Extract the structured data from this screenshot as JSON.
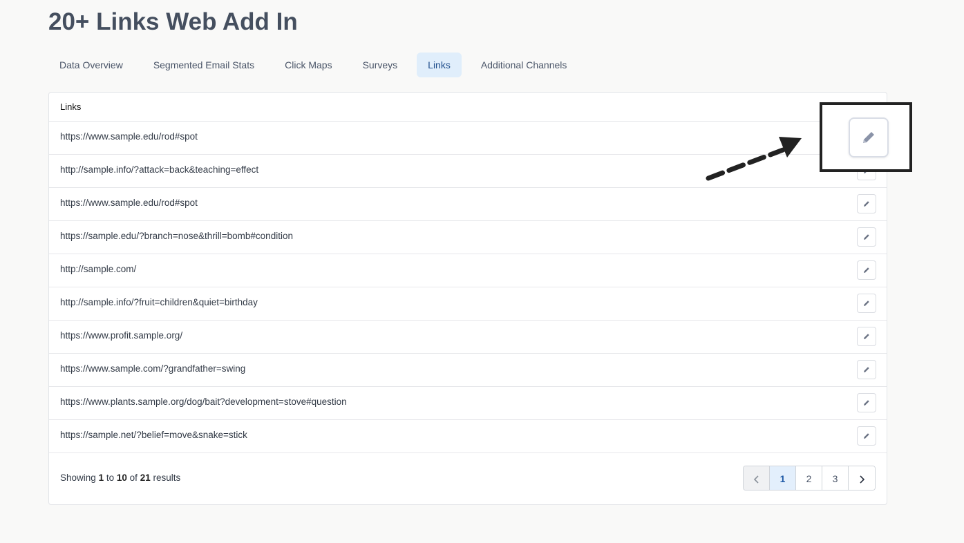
{
  "page": {
    "title": "20+ Links Web Add In"
  },
  "tabs": [
    {
      "label": "Data Overview",
      "active": false
    },
    {
      "label": "Segmented Email Stats",
      "active": false
    },
    {
      "label": "Click Maps",
      "active": false
    },
    {
      "label": "Surveys",
      "active": false
    },
    {
      "label": "Links",
      "active": true
    },
    {
      "label": "Additional Channels",
      "active": false
    }
  ],
  "table": {
    "header": "Links",
    "rows": [
      {
        "url": "https://www.sample.edu/rod#spot",
        "action_icon": "pencil-icon"
      },
      {
        "url": "http://sample.info/?attack=back&teaching=effect",
        "action_icon": "pencil-icon"
      },
      {
        "url": "https://www.sample.edu/rod#spot",
        "action_icon": "pencil-icon"
      },
      {
        "url": "https://sample.edu/?branch=nose&thrill=bomb#condition",
        "action_icon": "pencil-icon"
      },
      {
        "url": "http://sample.com/",
        "action_icon": "pencil-icon"
      },
      {
        "url": "http://sample.info/?fruit=children&quiet=birthday",
        "action_icon": "pencil-icon"
      },
      {
        "url": "https://www.profit.sample.org/",
        "action_icon": "pencil-icon"
      },
      {
        "url": "https://www.sample.com/?grandfather=swing",
        "action_icon": "pencil-icon"
      },
      {
        "url": "https://www.plants.sample.org/dog/bait?development=stove#question",
        "action_icon": "pencil-icon"
      },
      {
        "url": "https://sample.net/?belief=move&snake=stick",
        "action_icon": "pencil-icon"
      }
    ]
  },
  "footer": {
    "showing_prefix": "Showing",
    "from": "1",
    "to_word": "to",
    "to": "10",
    "of_word": "of",
    "total": "21",
    "suffix": "results"
  },
  "pagination": {
    "prev_icon": "chevron-left-icon",
    "pages": [
      "1",
      "2",
      "3"
    ],
    "current": "1",
    "next_icon": "chevron-right-icon"
  },
  "colors": {
    "active_tab_bg": "#e0eefb",
    "active_tab_text": "#1f4e8c",
    "title": "#454f5f",
    "annotation": "#222222"
  }
}
